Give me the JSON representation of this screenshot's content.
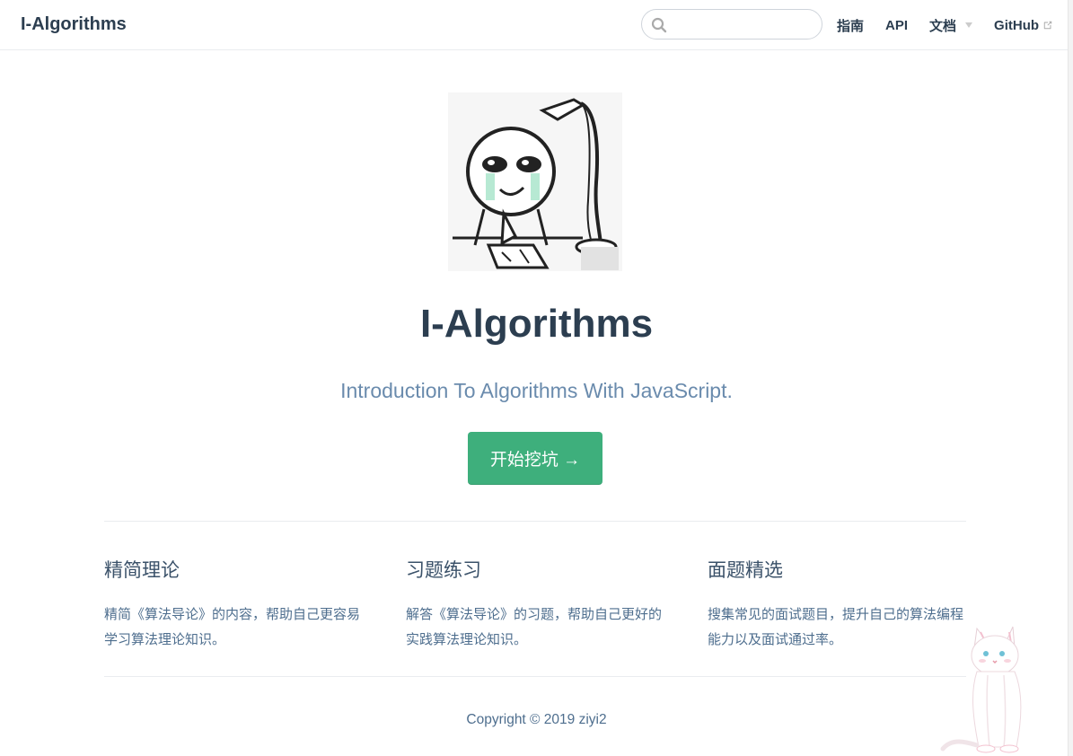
{
  "navbar": {
    "site_name": "I-Algorithms",
    "search_placeholder": "",
    "links": [
      {
        "label": "指南"
      },
      {
        "label": "API"
      },
      {
        "label": "文档"
      },
      {
        "label": "GitHub"
      }
    ]
  },
  "hero": {
    "title": "I-Algorithms",
    "description": "Introduction To Algorithms With JavaScript.",
    "action_label": "开始挖坑 →"
  },
  "features": [
    {
      "title": "精简理论",
      "details": "精简《算法导论》的内容，帮助自己更容易学习算法理论知识。"
    },
    {
      "title": "习题练习",
      "details": "解答《算法导论》的习题，帮助自己更好的实践算法理论知识。"
    },
    {
      "title": "面题精选",
      "details": "搜集常见的面试题目，提升自己的算法编程能力以及面试通过率。"
    }
  ],
  "footer": {
    "copyright": "Copyright © 2019 ziyi2"
  },
  "colors": {
    "accent": "#3eaf7c",
    "text": "#2c3e50",
    "description": "#6a8bad"
  },
  "icons": [
    "search-icon",
    "dropdown-arrow-icon",
    "external-link-icon",
    "hero-illustration",
    "cat-mascot"
  ]
}
